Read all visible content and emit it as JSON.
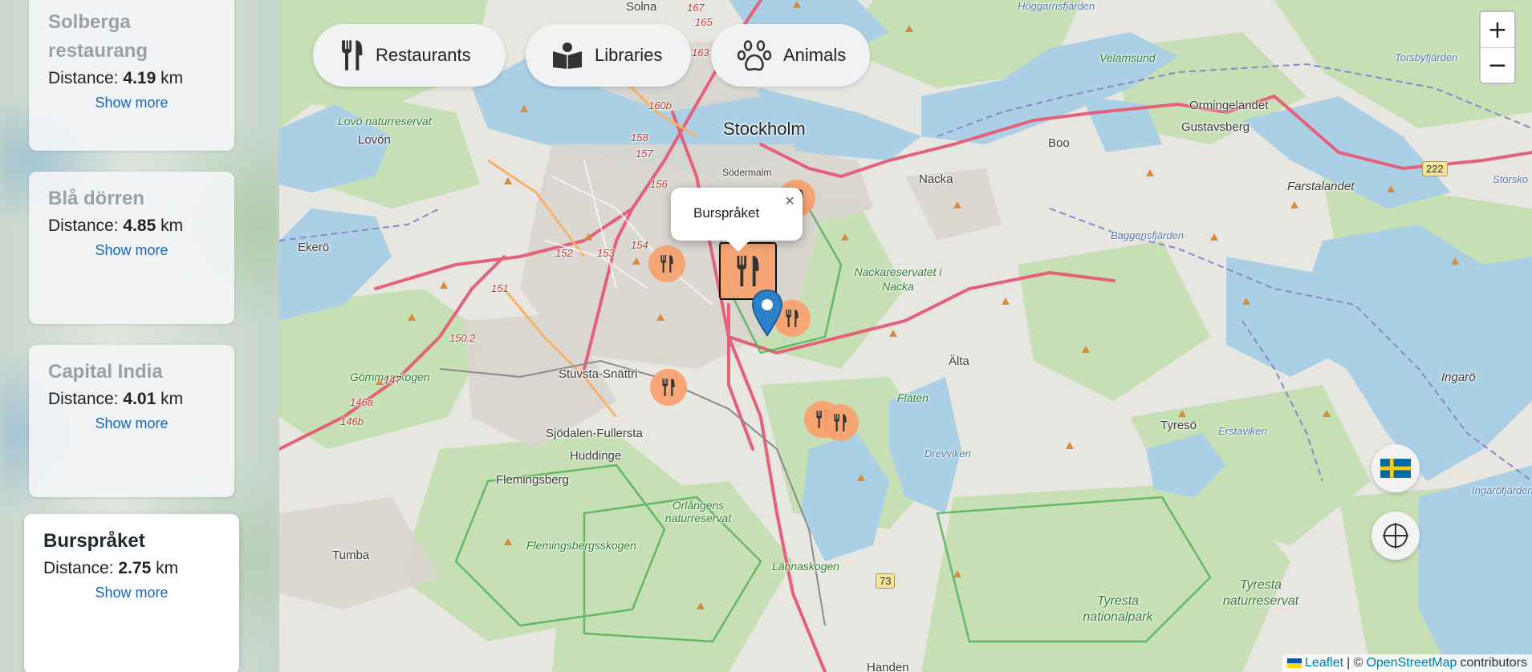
{
  "sidebar": {
    "cards": [
      {
        "name": "Solberga restaurang",
        "distance_label": "Distance:",
        "distance_value": "4.19",
        "distance_unit": "km",
        "more": "Show more"
      },
      {
        "name": "Blå dörren",
        "distance_label": "Distance:",
        "distance_value": "4.85",
        "distance_unit": "km",
        "more": "Show more"
      },
      {
        "name": "Capital India",
        "distance_label": "Distance:",
        "distance_value": "4.01",
        "distance_unit": "km",
        "more": "Show more"
      },
      {
        "name": "Burspråket",
        "distance_label": "Distance:",
        "distance_value": "2.75",
        "distance_unit": "km",
        "more": "Show more"
      }
    ]
  },
  "filters": [
    {
      "label": "Restaurants",
      "icon": "fork-knife-icon"
    },
    {
      "label": "Libraries",
      "icon": "book-icon"
    },
    {
      "label": "Animals",
      "icon": "paw-icon"
    }
  ],
  "map": {
    "zoom_in": "+",
    "zoom_out": "−",
    "popup": {
      "title": "Burspråket",
      "close": "×"
    },
    "attribution": {
      "leaflet": "Leaflet",
      "sep": "| ©",
      "osm": "OpenStreetMap",
      "contributors": "contributors"
    },
    "places": {
      "stockholm": "Stockholm",
      "solna": "Solna",
      "sodermalm": "Södermalm",
      "nacka": "Nacka",
      "boo": "Boo",
      "ormingelandet": "Ormingelandet",
      "gustavsberg": "Gustavsberg",
      "farstalandet": "Farstalandet",
      "lovon": "Lovön",
      "lovo_reservat": "Lovö naturreservat",
      "ekero": "Ekerö",
      "alta": "Älta",
      "tyreso": "Tyresö",
      "ingaro": "Ingarö",
      "stuvsta": "Stuvsta-Snättri",
      "sjodalen": "Sjödalen-Fullersta",
      "huddinge": "Huddinge",
      "flemingsberg": "Flemingsberg",
      "tumba": "Tumba",
      "gommarskogen": "Gömmarskogen",
      "flemingsbergsskogen": "Flemingsbergsskogen",
      "orlangen": "Orlångens naturreservat",
      "lannaskogen": "Lännaskogen",
      "tyresta_np": "Tyresta nationalpark",
      "tyresta_nr": "Tyresta naturreservat",
      "flaten": "Flaten",
      "nackareservatet": "Nackareservatet i Nacka",
      "velamsund": "Velamsund",
      "handen": "Handen",
      "drevviken": "Drevviken",
      "erstaviken": "Erstaviken",
      "baggensfjarden": "Baggensfjärden",
      "hoggarnsfjarden": "Höggarnsfjärden",
      "torsbyfjarden": "Torsbyfjärden",
      "ingarofjarden": "Ingaröfjärden",
      "storsko": "Storsko"
    },
    "road_numbers": [
      "158",
      "157",
      "156",
      "154",
      "152",
      "153",
      "151",
      "150.2",
      "147",
      "146a",
      "146b",
      "160b",
      "163",
      "167",
      "165"
    ],
    "shields": {
      "r222": "222",
      "r73": "73"
    }
  },
  "colors": {
    "marker": "#f8a16e",
    "card_name_muted": "#9aa0a6",
    "link": "#1565c0",
    "pin": "#2b82cb"
  }
}
